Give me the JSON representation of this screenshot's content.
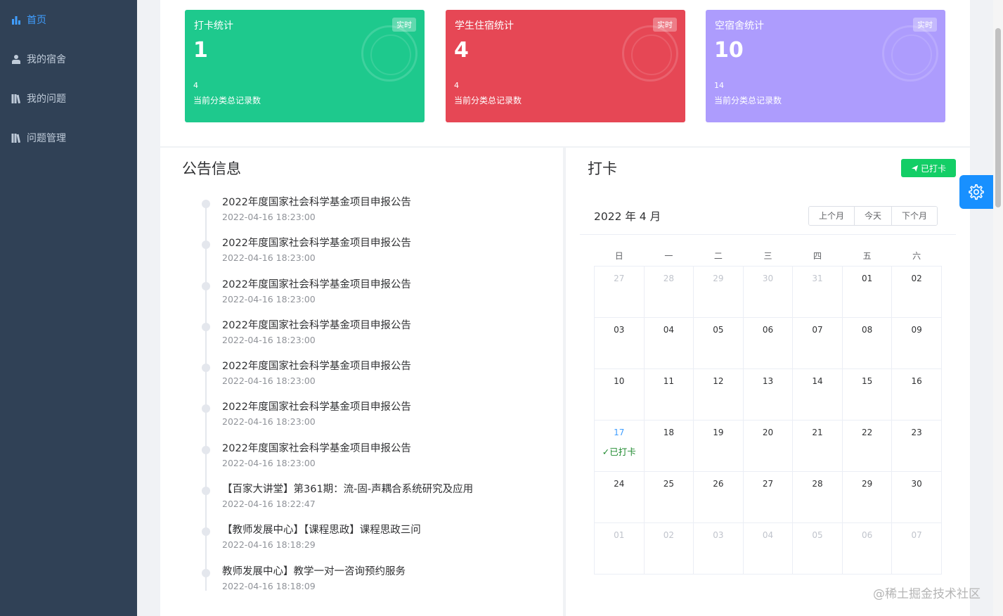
{
  "sidebar": {
    "items": [
      {
        "label": "首页",
        "icon": "bar-chart-icon",
        "active": true
      },
      {
        "label": "我的宿舍",
        "icon": "user-icon",
        "active": false
      },
      {
        "label": "我的问题",
        "icon": "books-icon",
        "active": false
      },
      {
        "label": "问题管理",
        "icon": "books-icon",
        "active": false
      }
    ]
  },
  "stats": [
    {
      "title": "打卡统计",
      "badge": "实时",
      "value": "1",
      "sub_value": "4",
      "sub_label": "当前分类总记录数",
      "color": "#1ec98d"
    },
    {
      "title": "学生住宿统计",
      "badge": "实时",
      "value": "4",
      "sub_value": "4",
      "sub_label": "当前分类总记录数",
      "color": "#e64755"
    },
    {
      "title": "空宿舍统计",
      "badge": "实时",
      "value": "10",
      "sub_value": "14",
      "sub_label": "当前分类总记录数",
      "color": "#ad9cfd"
    }
  ],
  "notice": {
    "title": "公告信息",
    "items": [
      {
        "title": "2022年度国家社会科学基金项目申报公告",
        "time": "2022-04-16 18:23:00"
      },
      {
        "title": "2022年度国家社会科学基金项目申报公告",
        "time": "2022-04-16 18:23:00"
      },
      {
        "title": "2022年度国家社会科学基金项目申报公告",
        "time": "2022-04-16 18:23:00"
      },
      {
        "title": "2022年度国家社会科学基金项目申报公告",
        "time": "2022-04-16 18:23:00"
      },
      {
        "title": "2022年度国家社会科学基金项目申报公告",
        "time": "2022-04-16 18:23:00"
      },
      {
        "title": "2022年度国家社会科学基金项目申报公告",
        "time": "2022-04-16 18:23:00"
      },
      {
        "title": "2022年度国家社会科学基金项目申报公告",
        "time": "2022-04-16 18:23:00"
      },
      {
        "title": "【百家大讲堂】第361期：流-固-声耦合系统研究及应用",
        "time": "2022-04-16 18:22:47"
      },
      {
        "title": "【教师发展中心】【课程思政】课程思政三问",
        "time": "2022-04-16 18:18:29"
      },
      {
        "title": "教师发展中心】教学一对一咨询预约服务",
        "time": "2022-04-16 18:18:09"
      }
    ]
  },
  "checkin": {
    "title": "打卡",
    "button_label": "已打卡",
    "month_label": "2022 年 4 月",
    "nav": [
      "上个月",
      "今天",
      "下个月"
    ],
    "weekdays": [
      "日",
      "一",
      "二",
      "三",
      "四",
      "五",
      "六"
    ],
    "checked_label": "✓已打卡",
    "weeks": [
      [
        {
          "d": "27",
          "o": true
        },
        {
          "d": "28",
          "o": true
        },
        {
          "d": "29",
          "o": true
        },
        {
          "d": "30",
          "o": true
        },
        {
          "d": "31",
          "o": true
        },
        {
          "d": "01"
        },
        {
          "d": "02"
        }
      ],
      [
        {
          "d": "03"
        },
        {
          "d": "04"
        },
        {
          "d": "05"
        },
        {
          "d": "06"
        },
        {
          "d": "07"
        },
        {
          "d": "08"
        },
        {
          "d": "09"
        }
      ],
      [
        {
          "d": "10"
        },
        {
          "d": "11"
        },
        {
          "d": "12"
        },
        {
          "d": "13"
        },
        {
          "d": "14"
        },
        {
          "d": "15"
        },
        {
          "d": "16"
        }
      ],
      [
        {
          "d": "17",
          "today": true,
          "checked": true
        },
        {
          "d": "18"
        },
        {
          "d": "19"
        },
        {
          "d": "20"
        },
        {
          "d": "21"
        },
        {
          "d": "22"
        },
        {
          "d": "23"
        }
      ],
      [
        {
          "d": "24"
        },
        {
          "d": "25"
        },
        {
          "d": "26"
        },
        {
          "d": "27"
        },
        {
          "d": "28"
        },
        {
          "d": "29"
        },
        {
          "d": "30"
        }
      ],
      [
        {
          "d": "01",
          "o": true
        },
        {
          "d": "02",
          "o": true
        },
        {
          "d": "03",
          "o": true
        },
        {
          "d": "04",
          "o": true
        },
        {
          "d": "05",
          "o": true
        },
        {
          "d": "06",
          "o": true
        },
        {
          "d": "07",
          "o": true
        }
      ]
    ]
  },
  "footer_watermark": "@稀土掘金技术社区",
  "colors": {
    "sidebar_bg": "#304156",
    "accent": "#409eff",
    "success": "#13ce66"
  }
}
